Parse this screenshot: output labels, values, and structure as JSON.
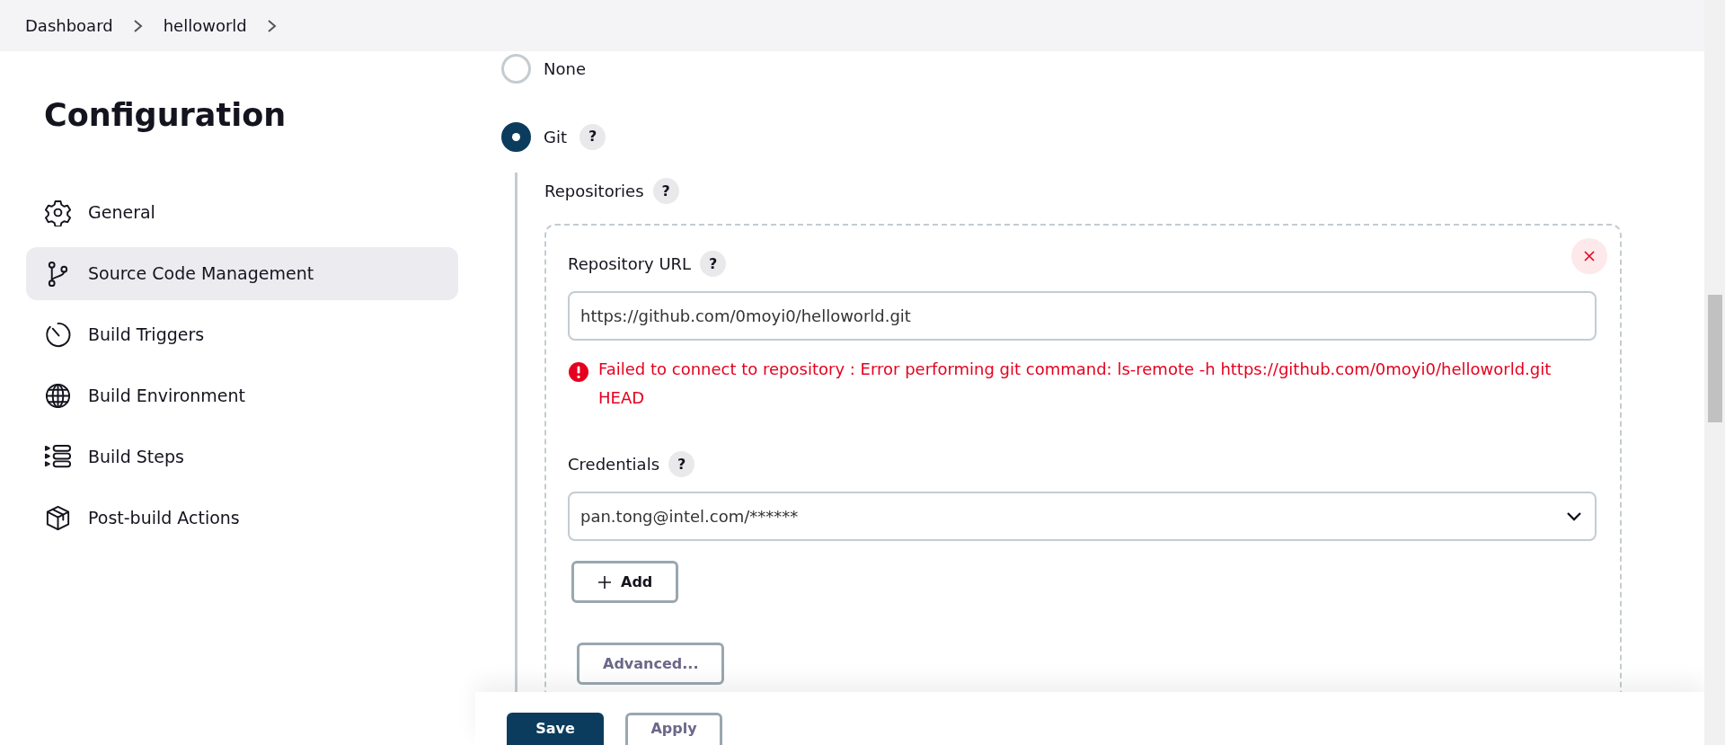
{
  "breadcrumbs": [
    {
      "label": "Dashboard"
    },
    {
      "label": "helloworld"
    }
  ],
  "sidebar": {
    "title": "Configuration",
    "items": [
      {
        "label": "General",
        "selected": false
      },
      {
        "label": "Source Code Management",
        "selected": true
      },
      {
        "label": "Build Triggers",
        "selected": false
      },
      {
        "label": "Build Environment",
        "selected": false
      },
      {
        "label": "Build Steps",
        "selected": false
      },
      {
        "label": "Post-build Actions",
        "selected": false
      }
    ]
  },
  "scm_options": [
    {
      "label": "None",
      "selected": false
    },
    {
      "label": "Git",
      "selected": true,
      "help": "?"
    }
  ],
  "git": {
    "repositories_label": "Repositories",
    "repositories_help": "?",
    "repository": {
      "url_label": "Repository URL",
      "url_help": "?",
      "url": "https://github.com/0moyi0/helloworld.git",
      "error": "Failed to connect to repository : Error performing git command:  ls-remote -h https://github.com/0moyi0/helloworld.git HEAD",
      "credentials_label": "Credentials",
      "credentials_help": "?",
      "credentials": "pan.tong@intel.com/******",
      "add_button": "Add",
      "advanced_button": "Advanced..."
    }
  },
  "footer": {
    "buttons": [
      {
        "label": "Save",
        "kind": "primary"
      },
      {
        "label": "Apply",
        "kind": "secondary"
      }
    ]
  }
}
